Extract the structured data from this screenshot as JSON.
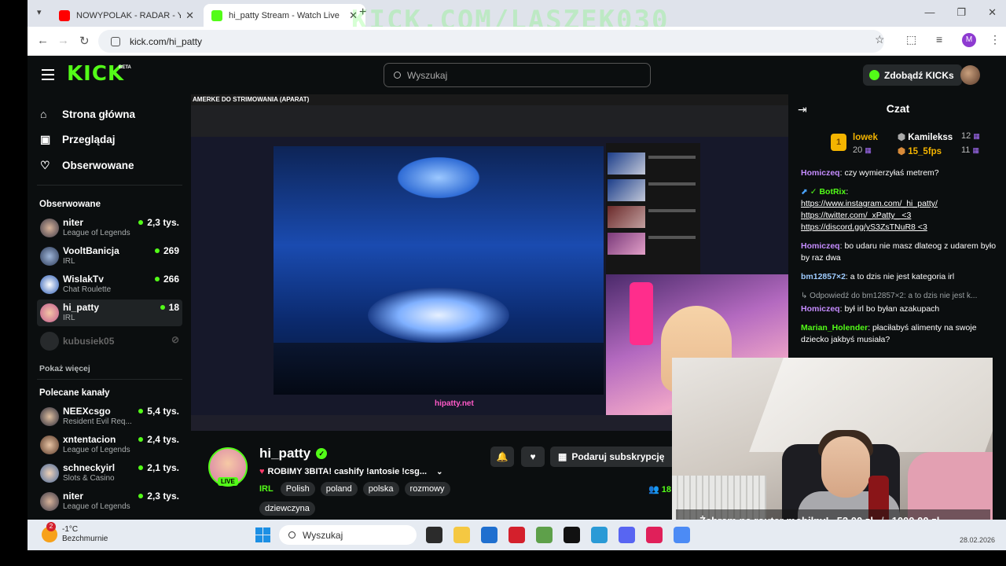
{
  "browser": {
    "tabs": [
      {
        "title": "NOWYPOLAK - RADAR - YouTube",
        "favicon_color": "#ff0000",
        "active": false
      },
      {
        "title": "hi_patty Stream - Watch Live",
        "favicon_color": "#53fc18",
        "active": true
      }
    ],
    "url": "kick.com/hi_patty",
    "profile_initial": "M",
    "overlay_watermark": "KICK.COM/LASZEK030"
  },
  "kick": {
    "logo": "KICK",
    "logo_badge": "BETA",
    "search_placeholder": "Wyszukaj",
    "get_kicks_label": "Zdobądź KICKs",
    "nav": [
      {
        "label": "Strona główna",
        "icon": "home-icon"
      },
      {
        "label": "Przeglądaj",
        "icon": "browse-icon"
      },
      {
        "label": "Obserwowane",
        "icon": "heart-icon"
      }
    ],
    "followed_title": "Obserwowane",
    "followed": [
      {
        "name": "niter",
        "category": "League of Legends",
        "viewers": "2,3 tys.",
        "live": true
      },
      {
        "name": "VooltBanicja",
        "category": "IRL",
        "viewers": "269",
        "live": true
      },
      {
        "name": "WislakTv",
        "category": "Chat Roulette",
        "viewers": "266",
        "live": true
      },
      {
        "name": "hi_patty",
        "category": "IRL",
        "viewers": "18",
        "live": true
      },
      {
        "name": "kubusiek05",
        "category": "",
        "viewers": "",
        "live": false
      }
    ],
    "show_more": "Pokaż więcej",
    "recommended_title": "Polecane kanały",
    "recommended": [
      {
        "name": "NEEXcsgo",
        "category": "Resident Evil Req...",
        "viewers": "5,4 tys."
      },
      {
        "name": "xntentacion",
        "category": "League of Legends",
        "viewers": "2,4 tys."
      },
      {
        "name": "schneckyirl",
        "category": "Slots & Casino",
        "viewers": "2,1 tys."
      },
      {
        "name": "niter",
        "category": "League of Legends",
        "viewers": "2,3 tys."
      }
    ]
  },
  "video": {
    "overlay_top_text": "AMERKE DO STRIMOWANIA (APARAT)",
    "donation_text": "hipatty.net"
  },
  "channel": {
    "name": "hi_patty",
    "live_label": "LIVE",
    "title": "ROBIMY 3BITA! cashify !antosie !csg...",
    "category": "IRL",
    "tags": [
      "Polish",
      "poland",
      "polska",
      "rozmowy",
      "dziewczyna"
    ],
    "subscribe_label": "Podaruj subskrypcję",
    "viewer_count": "18"
  },
  "chat": {
    "title": "Czat",
    "leaderboard": [
      {
        "rank": "1",
        "name": "lowek",
        "count": "20"
      },
      {
        "name": "Kamilekss",
        "count": "12"
      },
      {
        "name": "15_5fps",
        "count": "11"
      }
    ],
    "messages": [
      {
        "user": "Homiczeq",
        "color": "#c58cff",
        "text": "czy wymierzyłaś metrem?"
      },
      {
        "user": "BotRix",
        "color": "#53fc18",
        "links": [
          "https://www.instagram.com/_hi_patty/",
          "https://twitter.com/_xPatty_ <3",
          "https://discord.gg/yS3ZsTNuR8 <3"
        ]
      },
      {
        "user": "Homiczeq",
        "color": "#c58cff",
        "text": "bo udaru nie masz dlateog z udarem było by raz dwa"
      },
      {
        "user": "bm12857×2",
        "color": "#9ecbff",
        "text": "a to dzis nie jest kategoria irl"
      },
      {
        "reply": "Odpowiedź do bm12857×2: a to dzis nie jest k...",
        "user": "Homiczeq",
        "color": "#c58cff",
        "text": "był irl bo byłan azakupach"
      },
      {
        "user": "Marian_Holender",
        "color": "#53fc18",
        "text": "płaciłabyś alimenty na swoje dziecko jakbyś musiała?"
      }
    ]
  },
  "overlay_goal": {
    "label": "Żebram na router mobilny!",
    "current": "52,00 zł",
    "target": "1000,00 zł"
  },
  "taskbar": {
    "weather_temp": "-1°C",
    "weather_desc": "Bezchmurnie",
    "weather_badge": "2",
    "search_label": "Wyszukaj",
    "date": "28.02.2026"
  }
}
